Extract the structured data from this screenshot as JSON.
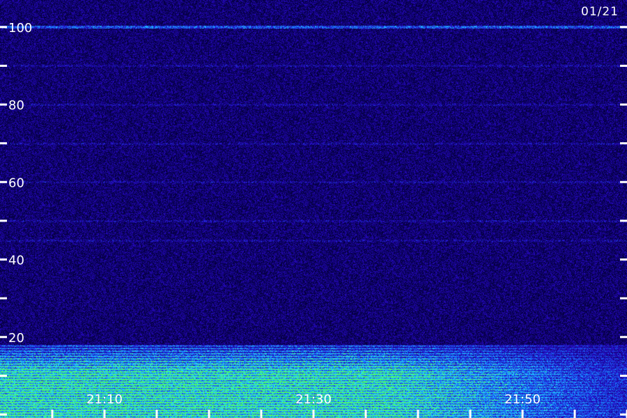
{
  "date_label": "01/21",
  "chart_data": {
    "type": "heatmap",
    "title": "",
    "xlabel": "",
    "ylabel": "",
    "ylim": [
      0,
      105
    ],
    "xlim": [
      "21:00",
      "22:00"
    ],
    "y_ticks_labeled": [
      20,
      40,
      60,
      80,
      100
    ],
    "y_ticks_minor": [
      0,
      10,
      30,
      50,
      70,
      90
    ],
    "x_ticks_labeled": [
      "21:10",
      "21:30",
      "21:50"
    ],
    "x_ticks_minor": [
      "21:05",
      "21:15",
      "21:20",
      "21:25",
      "21:35",
      "21:40",
      "21:45",
      "21:55",
      "22:00"
    ],
    "colormap": [
      "#000000",
      "#1a0050",
      "#2a10b0",
      "#2e58ff",
      "#30d0ff",
      "#40ff60"
    ],
    "features": [
      {
        "y": 100,
        "kind": "horizontal-line"
      },
      {
        "y_range": [
          0,
          18
        ],
        "kind": "strong-low-frequency-band"
      }
    ]
  }
}
